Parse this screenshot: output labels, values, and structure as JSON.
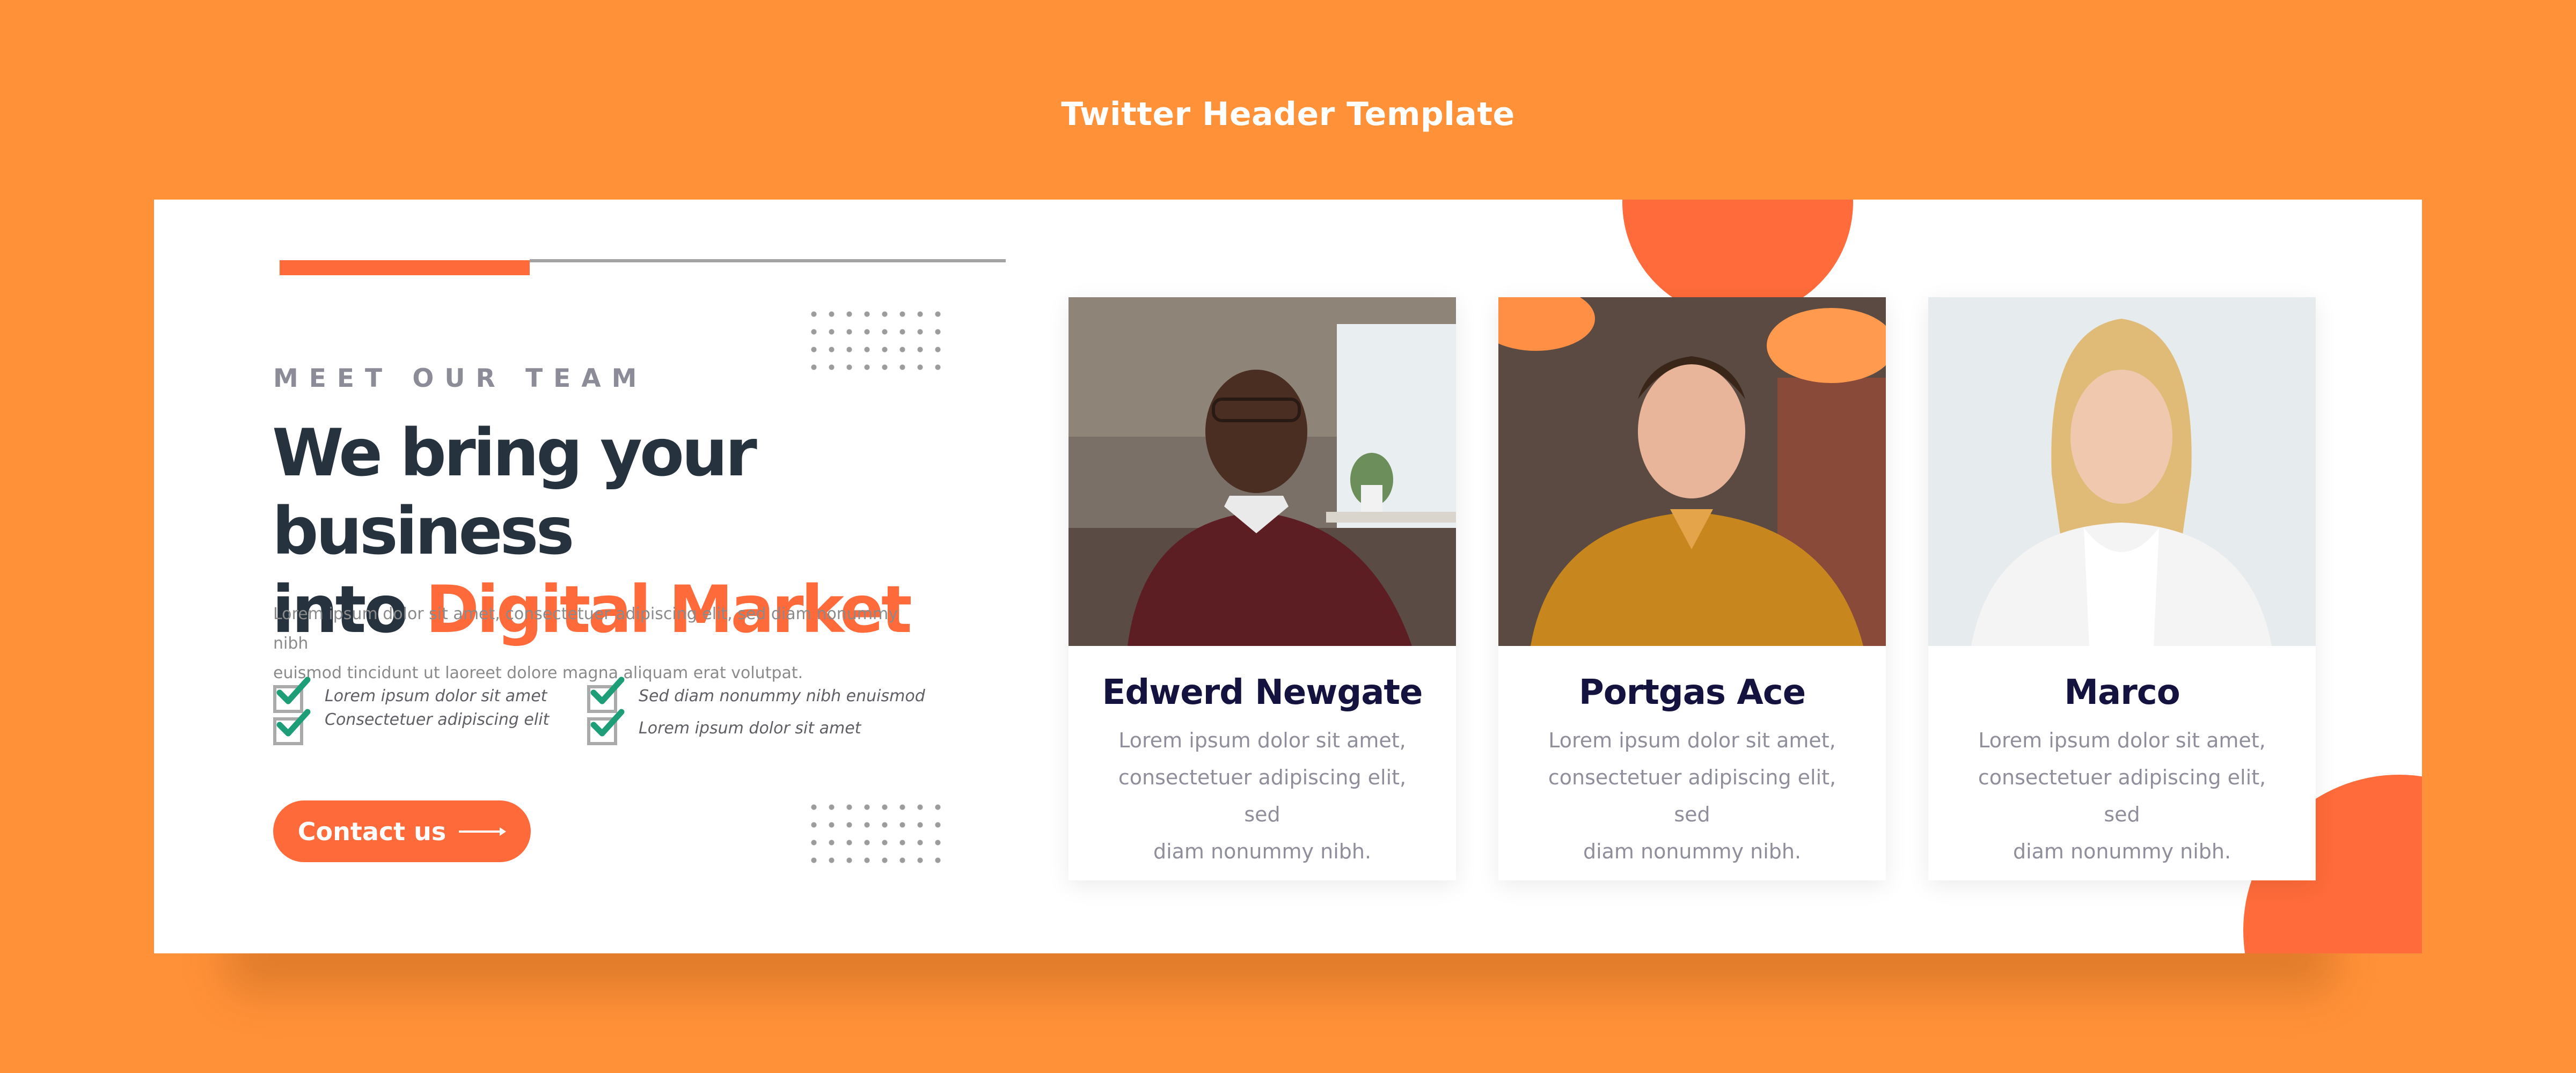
{
  "page": {
    "title": "Twitter Header Template"
  },
  "colors": {
    "background": "#ff9138",
    "accent": "#ff6a3b",
    "heading": "#27323f",
    "name": "#14123e",
    "check": "#1e9e78"
  },
  "banner": {
    "eyebrow": "MEET OUR TEAM",
    "headline_line1": "We bring your business",
    "headline_line2_prefix": "into ",
    "headline_line2_accent": "Digital Market",
    "lorem_line1": "Lorem ipsum dolor sit amet, consectetuer adipiscing elit, sed diam nonummy nibh",
    "lorem_line2": "euismod tincidunt ut laoreet dolore magna aliquam erat volutpat.",
    "checklist": [
      "Lorem ipsum dolor sit amet",
      "Consectetuer adipiscing elit",
      "Sed diam nonummy nibh enuismod",
      "Lorem ipsum dolor sit amet"
    ],
    "cta_label": "Contact us",
    "cta_icon": "arrow-right-icon"
  },
  "team": [
    {
      "name": "Edwerd Newgate",
      "desc_line1": "Lorem ipsum dolor sit amet,",
      "desc_line2": "consectetuer adipiscing elit, sed",
      "desc_line3": "diam nonummy nibh."
    },
    {
      "name": "Portgas Ace",
      "desc_line1": "Lorem ipsum dolor sit amet,",
      "desc_line2": "consectetuer adipiscing elit, sed",
      "desc_line3": "diam nonummy nibh."
    },
    {
      "name": "Marco",
      "desc_line1": "Lorem ipsum dolor sit amet,",
      "desc_line2": "consectetuer adipiscing elit, sed",
      "desc_line3": "diam nonummy nibh."
    }
  ]
}
